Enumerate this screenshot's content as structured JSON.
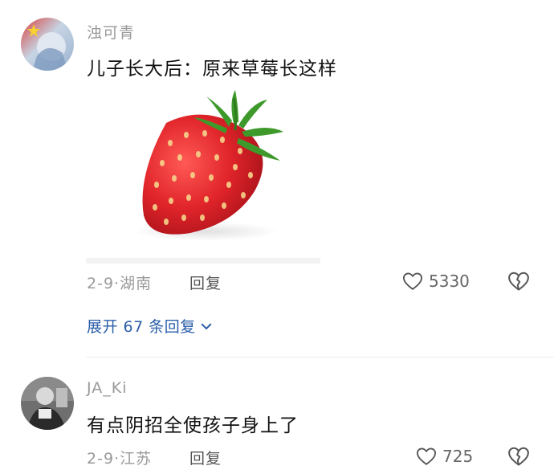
{
  "comments": [
    {
      "username": "浊可青",
      "text": "儿子长大后：原来草莓长这样",
      "meta": "2-9·湖南",
      "reply_label": "回复",
      "likes": "5330",
      "expand_label": "展开 67 条回复",
      "image_icon": "strawberry"
    },
    {
      "username": "JA_Ki",
      "text": "有点阴招全使孩子身上了",
      "meta": "2-9·江苏",
      "reply_label": "回复",
      "likes": "725"
    }
  ],
  "colors": {
    "link": "#2b5ea9",
    "meta": "#9a9a9a",
    "strawberry": "#e0242a"
  }
}
